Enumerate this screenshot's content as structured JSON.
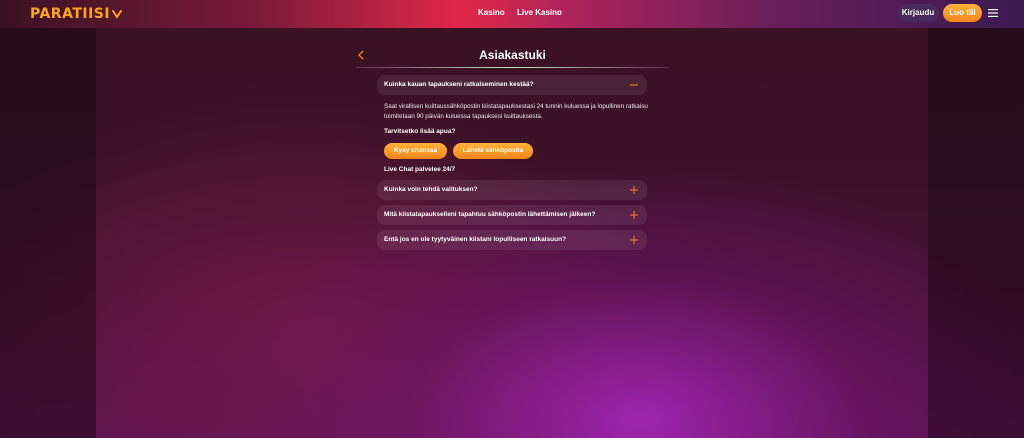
{
  "header": {
    "logo": "PARATIISI",
    "nav": [
      "Kasino",
      "Live Kasino"
    ],
    "login_label": "Kirjaudu",
    "register_label": "Luo tili",
    "menu_icon": "hamburger-menu-icon"
  },
  "support": {
    "title": "Asiakastuki",
    "back_icon": "chevron-left-icon",
    "faqs": [
      {
        "question": "Kuinka kauan tapaukseni ratkaiseminen kestää?",
        "expanded": true,
        "toggle_icon": "minus-icon"
      },
      {
        "question": "Kuinka voin tehdä valituksen?",
        "expanded": false,
        "toggle_icon": "plus-icon"
      },
      {
        "question": "Mitä kiistatapaukselleni tapahtuu sähköpostin lähettämisen jälkeen?",
        "expanded": false,
        "toggle_icon": "plus-icon"
      },
      {
        "question": "Entä jos en ole tyytyväinen kiistani lopulliseen ratkaisuun?",
        "expanded": false,
        "toggle_icon": "plus-icon"
      }
    ],
    "answer": "Saat virallisen kuittaussähköpostin kiistatapauksestasi 24 tunnin kuluessa ja lopullinen ratkaisu toimitetaan 90 päivän kuluessa tapauksesi kuittauksesta.",
    "help_question": "Tarvitsetko lisää apua?",
    "chat_button": "Kysy chatissa",
    "email_button": "Lähetä sähköpostia",
    "live_chat_note": "Live Chat palvelee 24/7"
  },
  "colors": {
    "accent": "#f5841a",
    "header_red": "#e0284a"
  }
}
